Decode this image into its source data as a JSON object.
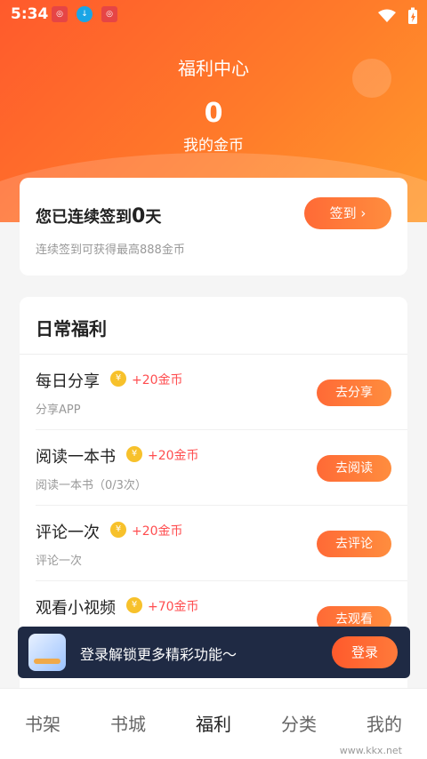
{
  "status": {
    "time": "5:34",
    "wifi_icon": "wifi-icon",
    "battery_icon": "battery-charging-icon",
    "apps": [
      {
        "name": "app-notification-icon-1",
        "label": "◎",
        "color": "#e64545"
      },
      {
        "name": "download-icon",
        "label": "↓",
        "color": "#1aa5e6"
      },
      {
        "name": "app-notification-icon-2",
        "label": "◎",
        "color": "#e64545"
      }
    ]
  },
  "header": {
    "title": "福利中心",
    "coins_value": "0",
    "coins_label": "我的金币"
  },
  "signin": {
    "title_prefix": "您已连续签到",
    "days": "0",
    "title_suffix": "天",
    "subtitle": "连续签到可获得最高888金币",
    "button": "签到 ›"
  },
  "daily": {
    "title": "日常福利",
    "tasks": [
      {
        "title": "每日分享",
        "reward": "+20金币",
        "sub": "分享APP",
        "button": "去分享"
      },
      {
        "title": "阅读一本书",
        "reward": "+20金币",
        "sub": "阅读一本书（0/3次）",
        "button": "去阅读"
      },
      {
        "title": "评论一次",
        "reward": "+20金币",
        "sub": "评论一次",
        "button": "去评论"
      },
      {
        "title": "观看小视频",
        "reward": "+70金币",
        "sub": "",
        "button": "去观看"
      }
    ]
  },
  "login_banner": {
    "text": "登录解锁更多精彩功能～",
    "button": "登录"
  },
  "tabbar": {
    "tabs": [
      "书架",
      "书城",
      "福利",
      "分类",
      "我的"
    ],
    "active_index": 2
  },
  "watermark": "www.kkx.net",
  "colors": {
    "accent": "#ff6a36",
    "reward": "#ff4d4f",
    "coin": "#f7c12b"
  }
}
